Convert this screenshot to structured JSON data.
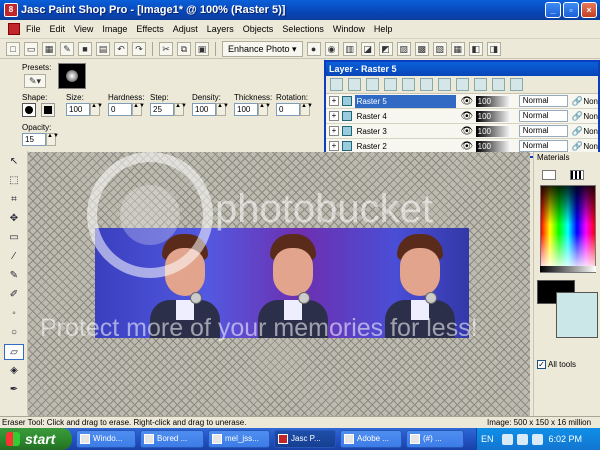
{
  "window": {
    "title": "Jasc Paint Shop Pro - [Image1* @ 100% (Raster 5)]",
    "app_icon_text": "8"
  },
  "menu": [
    "File",
    "Edit",
    "View",
    "Image",
    "Effects",
    "Adjust",
    "Layers",
    "Objects",
    "Selections",
    "Window",
    "Help"
  ],
  "toolbar": {
    "enhance_label": "Enhance Photo ▾"
  },
  "tool_options": {
    "presets_label": "Presets:",
    "shape_label": "Shape:",
    "size_label": "Size:",
    "size_value": "100",
    "hardness_label": "Hardness:",
    "hardness_value": "0",
    "step_label": "Step:",
    "step_value": "25",
    "density_label": "Density:",
    "density_value": "100",
    "thickness_label": "Thickness:",
    "thickness_value": "100",
    "rotation_label": "Rotation:",
    "rotation_value": "0",
    "opacity_label": "Opacity:",
    "opacity_value": "15"
  },
  "layers": {
    "title": "Layer - Raster 5",
    "rows": [
      {
        "name": "Raster 5",
        "opacity": "100",
        "blend": "Normal",
        "extra": "Non",
        "selected": true
      },
      {
        "name": "Raster 4",
        "opacity": "100",
        "blend": "Normal",
        "extra": "Non",
        "selected": false
      },
      {
        "name": "Raster 3",
        "opacity": "100",
        "blend": "Normal",
        "extra": "Non",
        "selected": false
      },
      {
        "name": "Raster 2",
        "opacity": "100",
        "blend": "Normal",
        "extra": "Non",
        "selected": false
      }
    ]
  },
  "materials": {
    "title": "Materials",
    "all_tools_label": "All tools"
  },
  "watermark": {
    "brand": "photobucket",
    "tagline": "Protect more of your memories for less!"
  },
  "status": {
    "message": "Eraser Tool: Click and drag to erase. Right-click and drag to unerase.",
    "image_info": "Image:  500 x 150 x 16 million"
  },
  "taskbar": {
    "start_label": "start",
    "tasks": [
      "Windo...",
      "Bored ...",
      "mel_jss...",
      "Jasc P...",
      "Adobe ...",
      "(#) ..."
    ],
    "active_task_index": 3,
    "lang": "EN",
    "clock": "6:02 PM"
  },
  "colors": {
    "title_blue": "#0a5fd8",
    "taskbar_blue": "#2456c9",
    "start_green": "#2e8a2e",
    "selection": "#316ac5"
  }
}
